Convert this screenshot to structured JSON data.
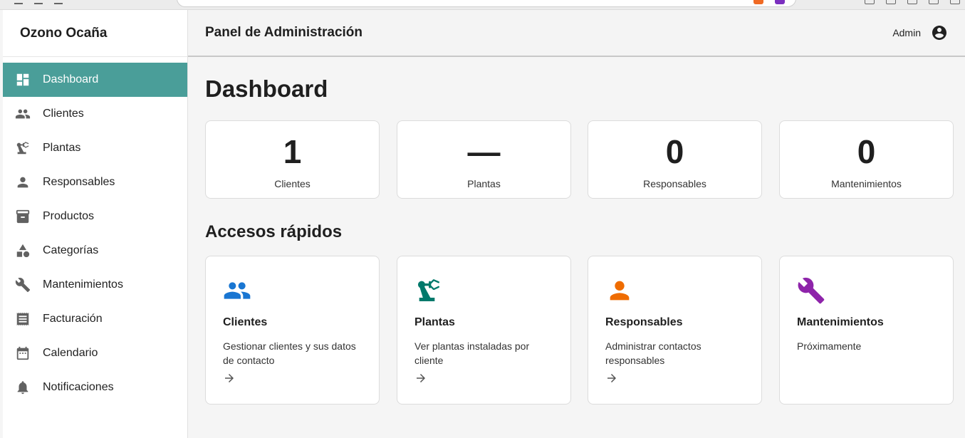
{
  "app": {
    "brand": "Ozono Ocaña",
    "title": "Panel de Administración",
    "user": "Admin"
  },
  "sidebar": {
    "items": [
      {
        "label": "Dashboard",
        "icon": "dashboard-icon",
        "active": true
      },
      {
        "label": "Clientes",
        "icon": "people-icon"
      },
      {
        "label": "Plantas",
        "icon": "precision-manufacturing-icon"
      },
      {
        "label": "Responsables",
        "icon": "person-icon"
      },
      {
        "label": "Productos",
        "icon": "archive-box-icon"
      },
      {
        "label": "Categorías",
        "icon": "category-icon"
      },
      {
        "label": "Mantenimientos",
        "icon": "wrench-icon"
      },
      {
        "label": "Facturación",
        "icon": "receipt-icon"
      },
      {
        "label": "Calendario",
        "icon": "calendar-icon"
      },
      {
        "label": "Notificaciones",
        "icon": "bell-icon"
      }
    ]
  },
  "main": {
    "page_title": "Dashboard",
    "stats": [
      {
        "value": "1",
        "label": "Clientes"
      },
      {
        "value": "—",
        "label": "Plantas"
      },
      {
        "value": "0",
        "label": "Responsables"
      },
      {
        "value": "0",
        "label": "Mantenimientos"
      }
    ],
    "quick_title": "Accesos rápidos",
    "quick_links": [
      {
        "title": "Clientes",
        "description": "Gestionar clientes y sus datos de contacto",
        "icon": "people-icon",
        "color": "#1976d2",
        "arrow": true
      },
      {
        "title": "Plantas",
        "description": "Ver plantas instaladas por cliente",
        "icon": "precision-manufacturing-icon",
        "color": "#00796b",
        "arrow": true
      },
      {
        "title": "Responsables",
        "description": "Administrar contactos responsables",
        "icon": "person-icon",
        "color": "#ef6c00",
        "arrow": true
      },
      {
        "title": "Mantenimientos",
        "description": "Próximamente",
        "icon": "wrench-icon",
        "color": "#8e24aa",
        "arrow": false
      }
    ]
  }
}
